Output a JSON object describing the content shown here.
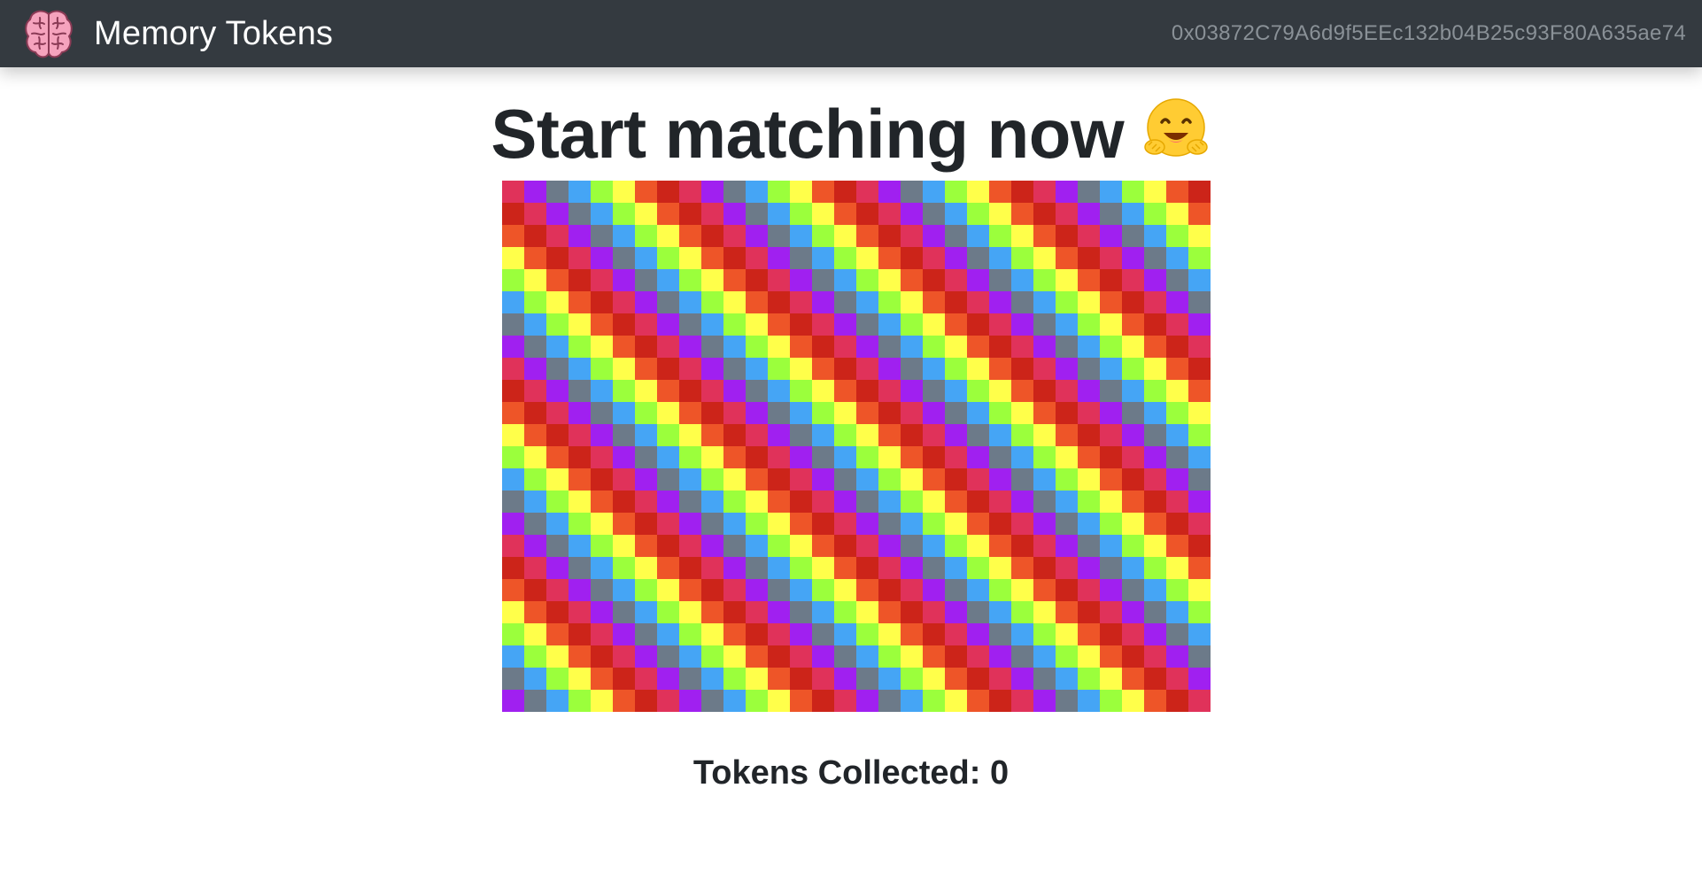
{
  "navbar": {
    "brand_icon": "brain-icon",
    "brand_text": "Memory Tokens",
    "account": "0x03872C79A6d9f5EEc132b04B25c93F80A635ae74"
  },
  "main": {
    "title": "Start matching now",
    "title_emoji": "hugging-face-emoji",
    "tokens_label": "Tokens Collected: ",
    "tokens_count": "0"
  },
  "board": {
    "columns": 32,
    "rows": 24,
    "palette": [
      "#e0325a",
      "#a020f0",
      "#6c7a89",
      "#45a5f5",
      "#9bff3c",
      "#ffff4a",
      "#ee5528",
      "#cc2419"
    ],
    "tile_state": "face-down"
  }
}
